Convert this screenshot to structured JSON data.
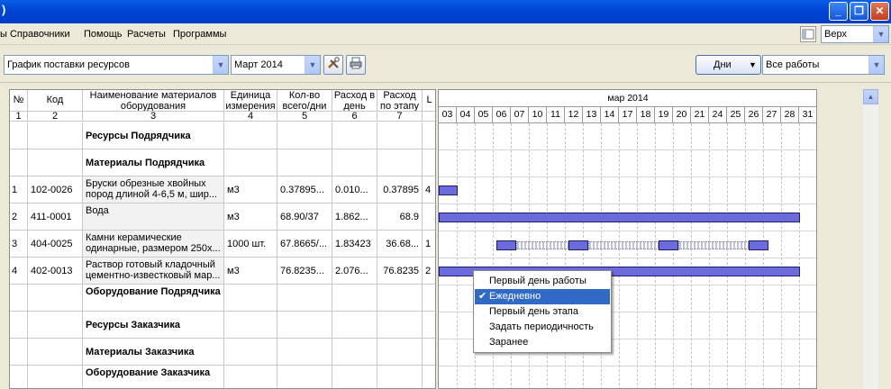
{
  "window": {
    "title": ")",
    "minimize": "_",
    "restore": "❐",
    "close": "✕"
  },
  "menu": {
    "items": [
      "ы Справочники",
      "Помощь",
      "Расчеты",
      "Программы"
    ],
    "position_label": "Верх"
  },
  "toolbar": {
    "report": "График поставки ресурсов",
    "month": "Март 2014",
    "days_button": "Дни",
    "filter": "Все работы",
    "settings_icon": "tools-icon",
    "print_icon": "printer-icon"
  },
  "table": {
    "headers": [
      {
        "title": "№",
        "num": "1"
      },
      {
        "title": "Код",
        "num": "2"
      },
      {
        "title": "Наименование материалов оборудования",
        "num": "3"
      },
      {
        "title": "Единица измерения",
        "num": "4"
      },
      {
        "title": "Кол-во всего/дни",
        "num": "5"
      },
      {
        "title": "Расход в день",
        "num": "6"
      },
      {
        "title": "Расход по этапу",
        "num": "7"
      },
      {
        "title": "L",
        "num": ""
      }
    ],
    "rows": [
      {
        "type": "group",
        "name": "Ресурсы Подрядчика"
      },
      {
        "type": "group",
        "name": "Материалы Подрядчика"
      },
      {
        "type": "item",
        "no": "1",
        "code": "102-0026",
        "name": "Бруски обрезные хвойных пород длиной 4-6,5 м, шир...",
        "unit": "м3",
        "qty": "0.37895...",
        "perday": "0.010...",
        "stage": "0.37895",
        "extra": "4"
      },
      {
        "type": "item",
        "no": "2",
        "code": "411-0001",
        "name": "Вода",
        "unit": "м3",
        "qty": "68.90/37",
        "perday": "1.862...",
        "stage": "68.9",
        "extra": ""
      },
      {
        "type": "item",
        "no": "3",
        "code": "404-0025",
        "name": "Камни керамические одинарные, размером 250х...",
        "unit": "1000 шт.",
        "qty": "67.8665/...",
        "perday": "1.83423",
        "stage": "36.68...",
        "extra": "1"
      },
      {
        "type": "item",
        "no": "4",
        "code": "402-0013",
        "name": "Раствор готовый кладочный цементно-известковый мар...",
        "unit": "м3",
        "qty": "76.8235...",
        "perday": "2.076...",
        "stage": "76.8235",
        "extra": "2"
      },
      {
        "type": "group",
        "name": "Оборудование Подрядчика"
      },
      {
        "type": "group",
        "name": "Ресурсы Заказчика"
      },
      {
        "type": "group",
        "name": "Материалы Заказчика"
      },
      {
        "type": "group",
        "name": "Оборудование Заказчика"
      }
    ]
  },
  "gantt": {
    "month": "мар 2014",
    "days": [
      "03",
      "04",
      "05",
      "06",
      "07",
      "10",
      "11",
      "12",
      "13",
      "14",
      "17",
      "18",
      "19",
      "20",
      "21",
      "24",
      "25",
      "26",
      "27",
      "28",
      "31"
    ]
  },
  "context_menu": {
    "items": [
      "Первый день работы",
      "Ежедневно",
      "Первый день этапа",
      "Задать периодичность",
      "Заранее"
    ],
    "selected": 1,
    "check": "✔"
  }
}
